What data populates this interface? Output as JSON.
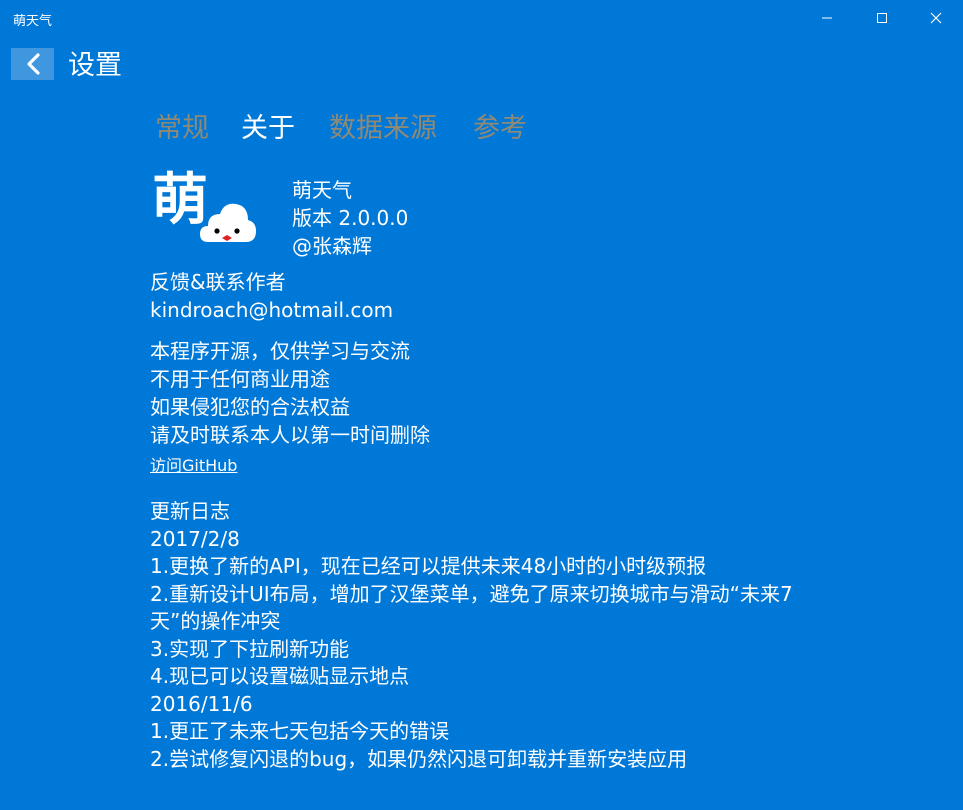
{
  "window": {
    "title": "萌天气"
  },
  "header": {
    "title": "设置"
  },
  "tabs": [
    {
      "label": "常规",
      "active": false
    },
    {
      "label": "关于",
      "active": true
    },
    {
      "label": "数据来源",
      "active": false
    },
    {
      "label": "参考",
      "active": false
    }
  ],
  "logo": {
    "char": "萌"
  },
  "app": {
    "name": "萌天气",
    "version": "版本 2.0.0.0",
    "author": "@张森辉"
  },
  "feedback": {
    "label": "反馈&联系作者",
    "email": "kindroach@hotmail.com"
  },
  "disclaimer": [
    "本程序开源，仅供学习与交流",
    "不用于任何商业用途",
    "如果侵犯您的合法权益",
    "请及时联系本人以第一时间删除"
  ],
  "github_link": "访问GitHub",
  "changelog": {
    "title": "更新日志",
    "entries": [
      {
        "date": "2017/2/8",
        "items": [
          "1.更换了新的API，现在已经可以提供未来48小时的小时级预报",
          "2.重新设计UI布局，增加了汉堡菜单，避免了原来切换城市与滑动“未来7天”的操作冲突",
          "3.实现了下拉刷新功能",
          "4.现已可以设置磁贴显示地点"
        ]
      },
      {
        "date": "2016/11/6",
        "items": [
          "1.更正了未来七天包括今天的错误",
          "2.尝试修复闪退的bug，如果仍然闪退可卸载并重新安装应用"
        ]
      }
    ]
  },
  "colors": {
    "background": "#0078d7",
    "back_button": "#3f97e0",
    "inactive_tab": "#8f8a76",
    "text": "#ffffff"
  }
}
